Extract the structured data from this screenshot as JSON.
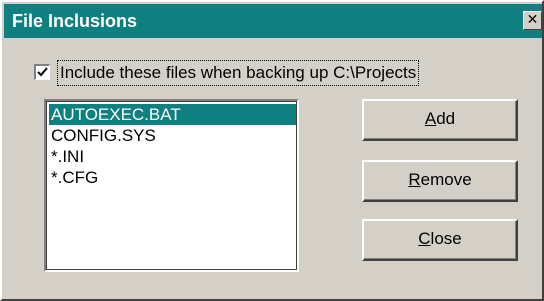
{
  "window": {
    "title": "File Inclusions",
    "close_glyph": "✕"
  },
  "option": {
    "checked": true,
    "label": "Include these files when backing up C:\\Projects"
  },
  "file_list": {
    "items": [
      {
        "label": "AUTOEXEC.BAT",
        "selected": true
      },
      {
        "label": "CONFIG.SYS",
        "selected": false
      },
      {
        "label": "*.INI",
        "selected": false
      },
      {
        "label": "*.CFG",
        "selected": false
      }
    ]
  },
  "buttons": {
    "add": {
      "mnemonic": "A",
      "rest": "dd"
    },
    "remove": {
      "mnemonic": "R",
      "rest": "emove"
    },
    "close": {
      "mnemonic": "C",
      "rest": "lose"
    }
  },
  "colors": {
    "titlebar": "#0f7f80",
    "selection": "#0f7f80",
    "face": "#d4d0c8"
  }
}
